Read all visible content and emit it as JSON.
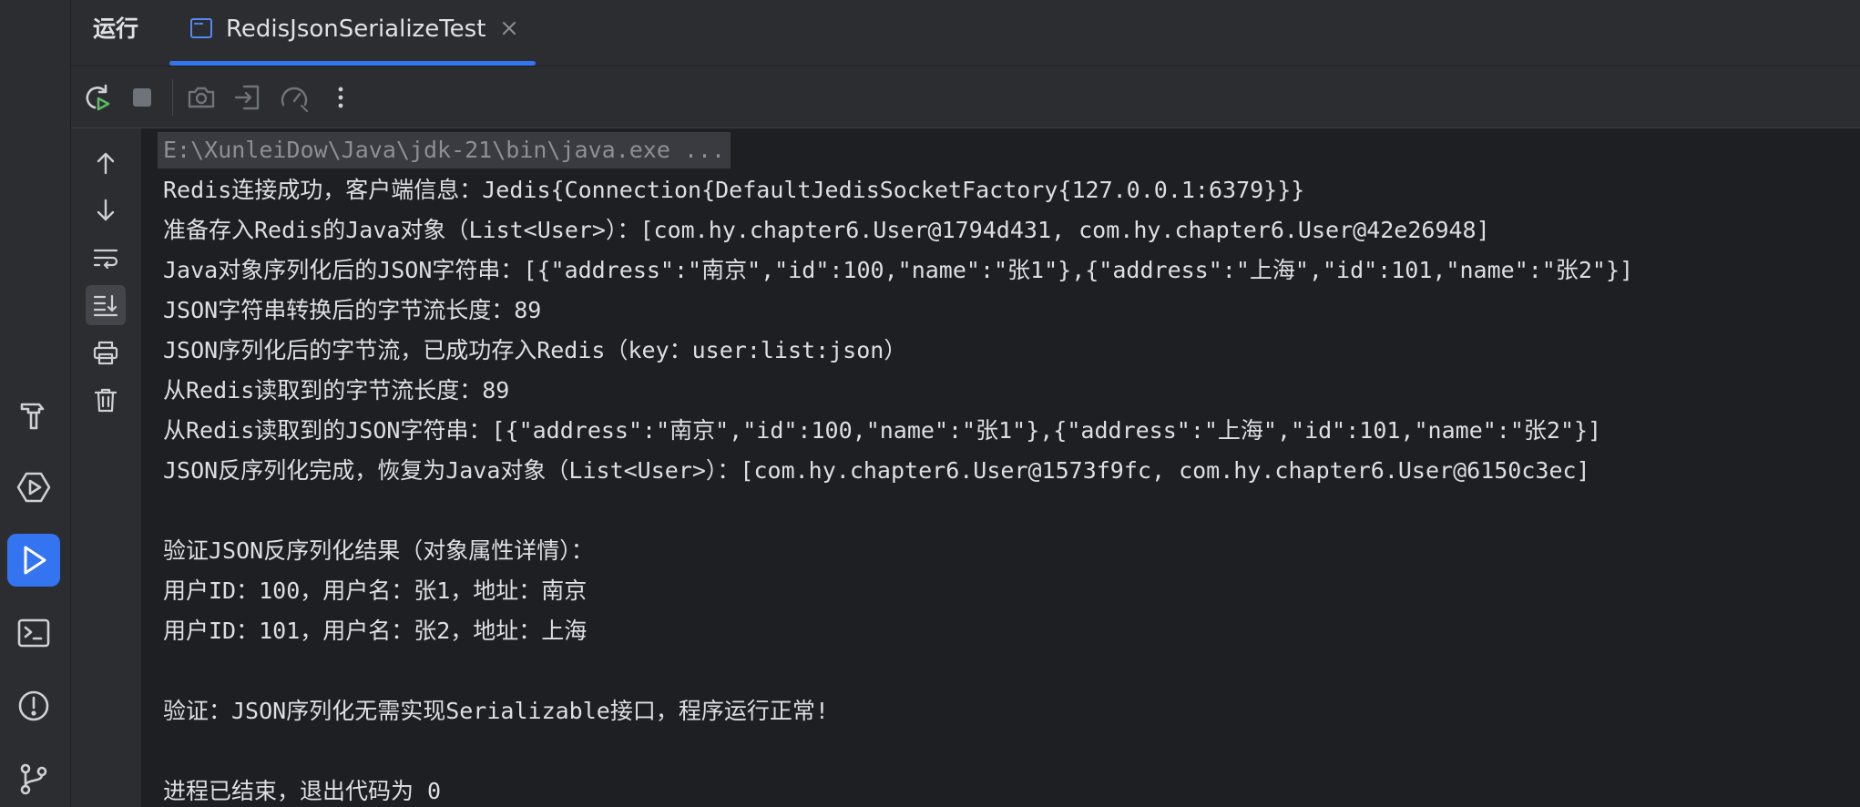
{
  "header": {
    "panel_title": "运行",
    "tab_label": "RedisJsonSerializeTest"
  },
  "colors": {
    "accent": "#3574f0",
    "background": "#1e1f22",
    "panel": "#2b2d30",
    "text": "#dcdfe4",
    "muted": "#8c8f94"
  },
  "leftbar_icons": [
    "hammer-icon",
    "services-icon",
    "run-icon",
    "terminal-icon",
    "problems-icon",
    "git-branch-icon"
  ],
  "toolbar_icons": [
    "rerun-icon",
    "stop-icon",
    "screenshot-icon",
    "exit-icon",
    "profiler-icon",
    "more-icon"
  ],
  "console_action_icons": [
    "scroll-up-icon",
    "scroll-down-icon",
    "soft-wrap-icon",
    "scroll-to-end-icon",
    "print-icon",
    "trash-icon"
  ],
  "console": {
    "command": "E:\\XunleiDow\\Java\\jdk-21\\bin\\java.exe ...",
    "lines": [
      "Redis连接成功，客户端信息：Jedis{Connection{DefaultJedisSocketFactory{127.0.0.1:6379}}}",
      "准备存入Redis的Java对象（List<User>）：[com.hy.chapter6.User@1794d431, com.hy.chapter6.User@42e26948]",
      "Java对象序列化后的JSON字符串：[{\"address\":\"南京\",\"id\":100,\"name\":\"张1\"},{\"address\":\"上海\",\"id\":101,\"name\":\"张2\"}]",
      "JSON字符串转换后的字节流长度：89",
      "JSON序列化后的字节流，已成功存入Redis（key：user:list:json）",
      "从Redis读取到的字节流长度：89",
      "从Redis读取到的JSON字符串：[{\"address\":\"南京\",\"id\":100,\"name\":\"张1\"},{\"address\":\"上海\",\"id\":101,\"name\":\"张2\"}]",
      "JSON反序列化完成，恢复为Java对象（List<User>）：[com.hy.chapter6.User@1573f9fc, com.hy.chapter6.User@6150c3ec]",
      "",
      "验证JSON反序列化结果（对象属性详情）：",
      "用户ID：100，用户名：张1，地址：南京",
      "用户ID：101，用户名：张2，地址：上海",
      "",
      "验证：JSON序列化无需实现Serializable接口，程序运行正常!",
      "",
      "进程已结束，退出代码为 0"
    ]
  }
}
